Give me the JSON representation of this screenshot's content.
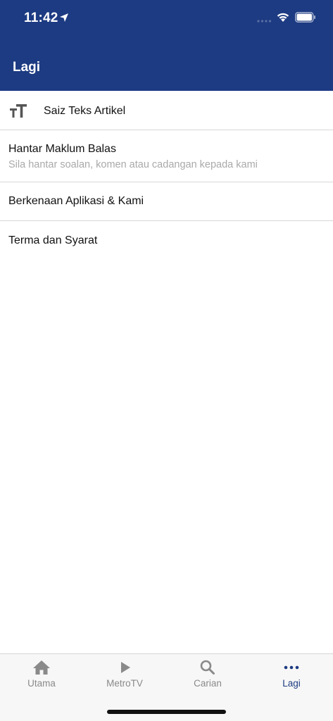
{
  "status_bar": {
    "time": "11:42",
    "icons": [
      "location-arrow-icon",
      "signal-icon",
      "wifi-icon",
      "battery-icon"
    ]
  },
  "header": {
    "title": "Lagi",
    "background_color": "#1d3b82"
  },
  "list": {
    "text_size": {
      "icon": "text-size-icon",
      "label": "Saiz Teks Artikel"
    },
    "feedback": {
      "label": "Hantar Maklum Balas",
      "subtitle": "Sila hantar soalan, komen atau cadangan kepada kami"
    },
    "about": {
      "label": "Berkenaan Aplikasi & Kami"
    },
    "terms": {
      "label": "Terma dan Syarat"
    }
  },
  "tabbar": {
    "tabs": [
      {
        "label": "Utama",
        "icon": "home-icon",
        "active": false
      },
      {
        "label": "MetroTV",
        "icon": "play-icon",
        "active": false
      },
      {
        "label": "Carian",
        "icon": "search-icon",
        "active": false
      },
      {
        "label": "Lagi",
        "icon": "more-dots-icon",
        "active": true
      }
    ],
    "active_color": "#1d3b82",
    "inactive_color": "#8a8a8a"
  }
}
